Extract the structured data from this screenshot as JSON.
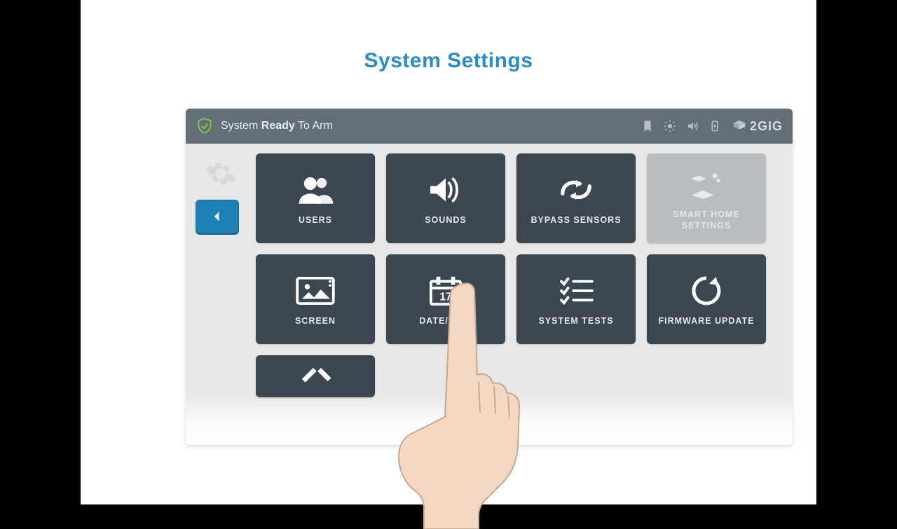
{
  "page_title": "System Settings",
  "status": {
    "prefix": "System",
    "ready": "Ready",
    "suffix": "To Arm"
  },
  "brand": "2GIG",
  "tiles": {
    "users": "USERS",
    "sounds": "SOUNDS",
    "bypass": "BYPASS SENSORS",
    "smarthome": "SMART HOME SETTINGS",
    "screen": "SCREEN",
    "datetime": "DATE/TIME",
    "systests": "SYSTEM TESTS",
    "firmware": "FIRMWARE UPDATE"
  },
  "calendar_day": "17"
}
